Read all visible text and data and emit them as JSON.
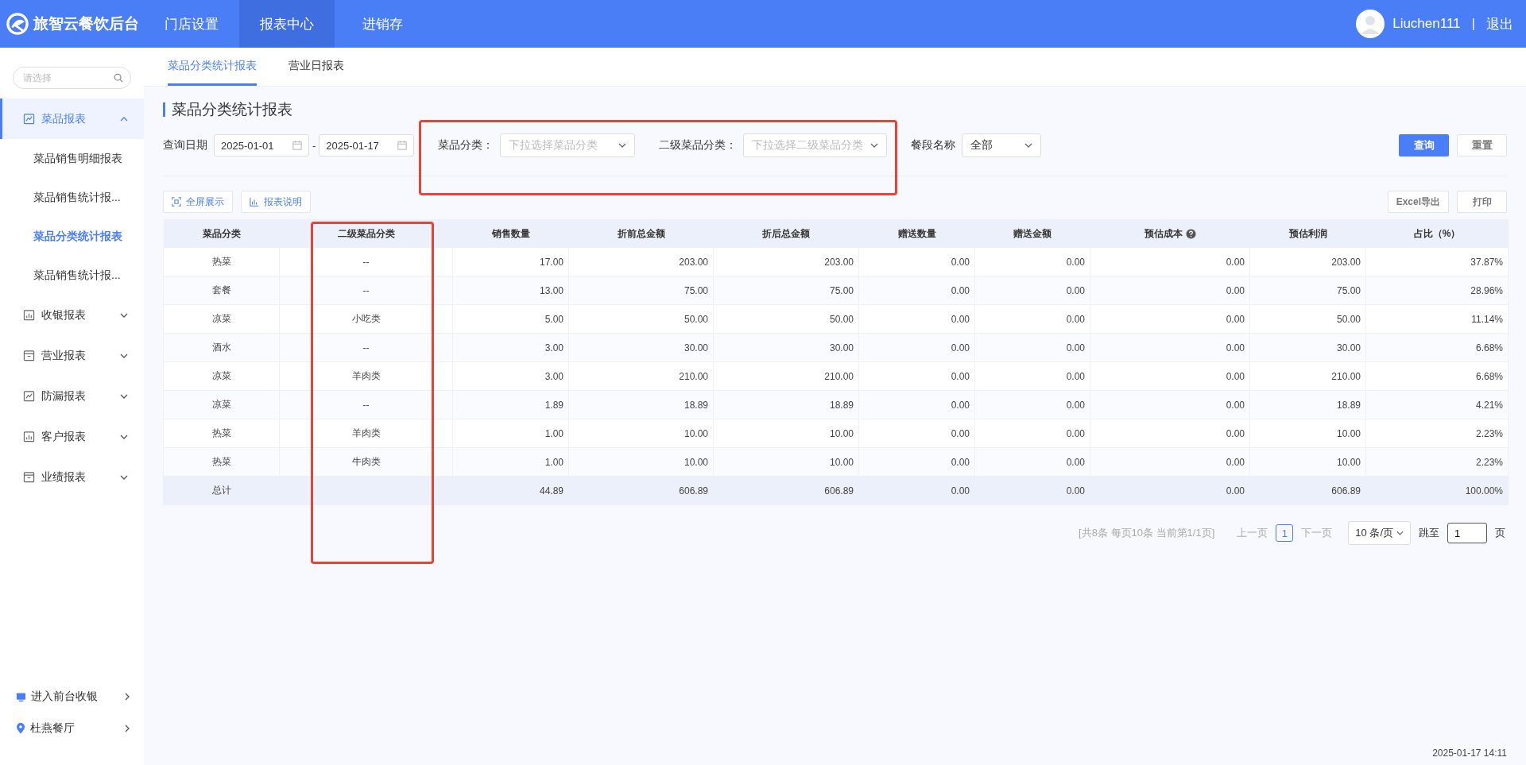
{
  "app": {
    "title": "旅智云餐饮后台"
  },
  "top_nav": [
    {
      "label": "门店设置",
      "selected": false
    },
    {
      "label": "报表中心",
      "selected": true
    },
    {
      "label": "进销存",
      "selected": false
    }
  ],
  "user": {
    "name": "Liuchen111",
    "separator": "|",
    "logout": "退出"
  },
  "sidebar": {
    "search": {
      "placeholder": "请选择"
    },
    "groups": [
      {
        "label": "菜品报表",
        "expanded": true,
        "selected": true,
        "children": [
          {
            "label": "菜品销售明细报表",
            "selected": false
          },
          {
            "label": "菜品销售统计报...",
            "selected": false
          },
          {
            "label": "菜品分类统计报表",
            "selected": true
          },
          {
            "label": "菜品销售统计报...",
            "selected": false
          }
        ]
      },
      {
        "label": "收银报表",
        "expanded": false,
        "selected": false
      },
      {
        "label": "营业报表",
        "expanded": false,
        "selected": false
      },
      {
        "label": "防漏报表",
        "expanded": false,
        "selected": false
      },
      {
        "label": "客户报表",
        "expanded": false,
        "selected": false
      },
      {
        "label": "业绩报表",
        "expanded": false,
        "selected": false
      }
    ],
    "footer": [
      {
        "label": "进入前台收银",
        "kind": "cashier"
      },
      {
        "label": "杜燕餐厅",
        "kind": "location"
      }
    ]
  },
  "sub_tabs": [
    {
      "label": "菜品分类统计报表",
      "selected": true
    },
    {
      "label": "营业日报表",
      "selected": false
    }
  ],
  "page_title": "菜品分类统计报表",
  "filters": {
    "date": {
      "label": "查询日期",
      "from": "2025-01-01",
      "separator": "-",
      "to": "2025-01-17"
    },
    "category": {
      "label": "菜品分类：",
      "placeholder": "下拉选择菜品分类"
    },
    "sub_category": {
      "label": "二级菜品分类：",
      "placeholder": "下拉选择二级菜品分类"
    },
    "meal_period": {
      "label": "餐段名称",
      "value": "全部"
    },
    "buttons": [
      {
        "label": "查询",
        "kind": "primary"
      },
      {
        "label": "重置",
        "kind": "default"
      }
    ]
  },
  "toolbar": {
    "left": [
      {
        "label": "全屏展示",
        "kind": "fullscreen"
      },
      {
        "label": "报表说明",
        "kind": "chart"
      }
    ],
    "right": [
      {
        "label": "Excel导出"
      },
      {
        "label": "打印"
      }
    ]
  },
  "table": {
    "columns": [
      {
        "label": "菜品分类",
        "help": false
      },
      {
        "label": "二级菜品分类",
        "help": false
      },
      {
        "label": "销售数量",
        "help": false
      },
      {
        "label": "折前总金额",
        "help": false
      },
      {
        "label": "折后总金额",
        "help": false
      },
      {
        "label": "赠送数量",
        "help": false
      },
      {
        "label": "赠送金额",
        "help": false
      },
      {
        "label": "预估成本",
        "help": true
      },
      {
        "label": "预估利润",
        "help": false
      },
      {
        "label": "占比（%）",
        "help": false
      }
    ],
    "rows": [
      [
        "热菜",
        "--",
        "17.00",
        "203.00",
        "203.00",
        "0.00",
        "0.00",
        "0.00",
        "203.00",
        "37.87%"
      ],
      [
        "套餐",
        "--",
        "13.00",
        "75.00",
        "75.00",
        "0.00",
        "0.00",
        "0.00",
        "75.00",
        "28.96%"
      ],
      [
        "凉菜",
        "小吃类",
        "5.00",
        "50.00",
        "50.00",
        "0.00",
        "0.00",
        "0.00",
        "50.00",
        "11.14%"
      ],
      [
        "酒水",
        "--",
        "3.00",
        "30.00",
        "30.00",
        "0.00",
        "0.00",
        "0.00",
        "30.00",
        "6.68%"
      ],
      [
        "凉菜",
        "羊肉类",
        "3.00",
        "210.00",
        "210.00",
        "0.00",
        "0.00",
        "0.00",
        "210.00",
        "6.68%"
      ],
      [
        "凉菜",
        "--",
        "1.89",
        "18.89",
        "18.89",
        "0.00",
        "0.00",
        "0.00",
        "18.89",
        "4.21%"
      ],
      [
        "热菜",
        "羊肉类",
        "1.00",
        "10.00",
        "10.00",
        "0.00",
        "0.00",
        "0.00",
        "10.00",
        "2.23%"
      ],
      [
        "热菜",
        "牛肉类",
        "1.00",
        "10.00",
        "10.00",
        "0.00",
        "0.00",
        "0.00",
        "10.00",
        "2.23%"
      ]
    ],
    "total": {
      "label": "总计",
      "values": [
        "44.89",
        "606.89",
        "606.89",
        "0.00",
        "0.00",
        "0.00",
        "606.89",
        "100.00%"
      ]
    }
  },
  "pagination": {
    "summary": "[共8条 每页10条 当前第1/1页]",
    "prev": "上一页",
    "pages": [
      {
        "label": "1",
        "selected": true
      }
    ],
    "next": "下一页",
    "page_size": "10 条/页",
    "jump_label": "跳至",
    "jump_value": "1",
    "jump_unit": "页"
  },
  "timestamp": "2025-01-17 14:11"
}
